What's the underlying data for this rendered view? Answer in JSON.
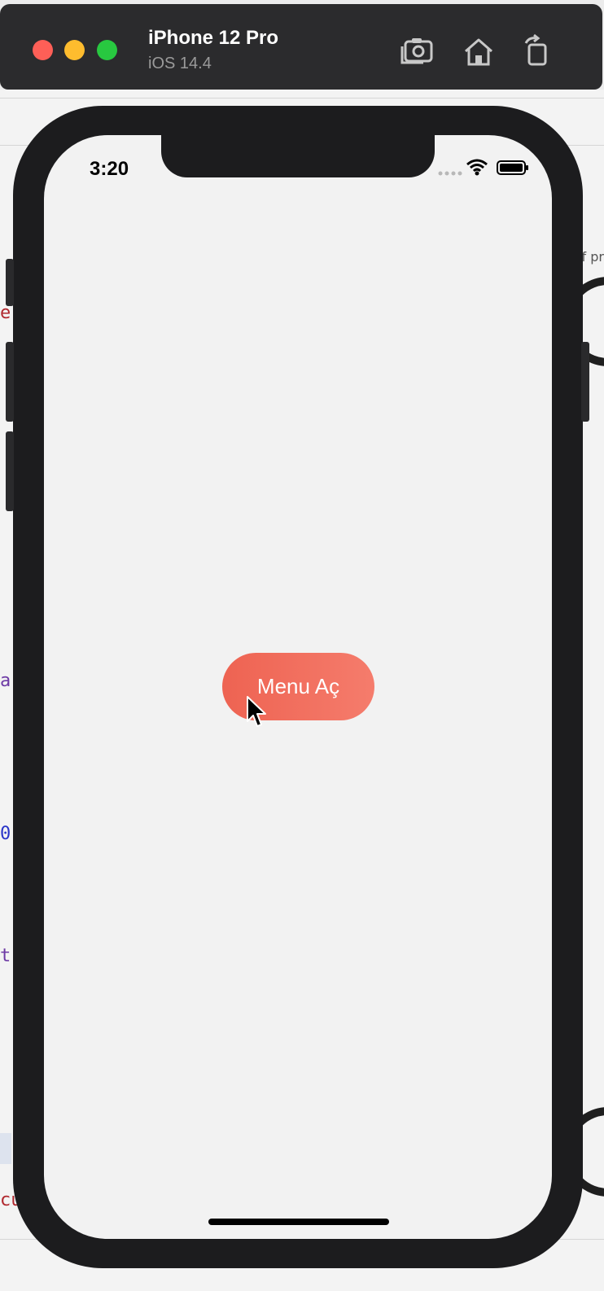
{
  "simulator": {
    "device_name": "iPhone 12 Pro",
    "os_version": "iOS 14.4",
    "toolbar_icons": [
      "screenshot-icon",
      "home-icon",
      "rotate-icon"
    ]
  },
  "background_editor": {
    "right_fragment": "f pr",
    "left_fragments": [
      "er",
      "a",
      "0",
      "t",
      "cu"
    ],
    "colors": {
      "red_token": "#b0282e",
      "purple_token": "#6d3aa5",
      "blue_token": "#2a35c8"
    }
  },
  "status_bar": {
    "time": "3:20",
    "icons": [
      "signal-dots-icon",
      "wifi-icon",
      "battery-icon"
    ]
  },
  "app": {
    "menu_button_label": "Menu Aç",
    "button_gradient": [
      "#ee6352",
      "#f57c6c"
    ],
    "screen_background": "#f2f2f2"
  }
}
